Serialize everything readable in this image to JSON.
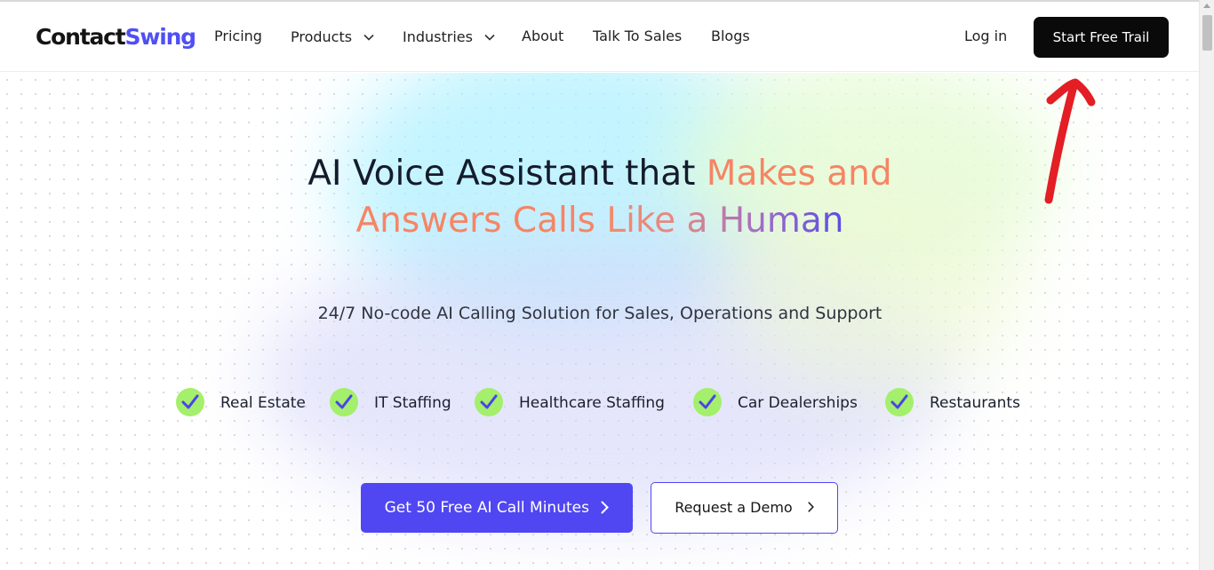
{
  "brand": {
    "logo_part1": "Contact",
    "logo_part2": "Swing",
    "accent_color": "#5046f2",
    "logo_swing_color": "#4f4ff5"
  },
  "nav": {
    "items": [
      {
        "label": "Pricing",
        "has_dropdown": false
      },
      {
        "label": "Products",
        "has_dropdown": true
      },
      {
        "label": "Industries",
        "has_dropdown": true
      },
      {
        "label": "About",
        "has_dropdown": false
      },
      {
        "label": "Talk To Sales",
        "has_dropdown": false
      },
      {
        "label": "Blogs",
        "has_dropdown": false
      }
    ],
    "login_label": "Log in",
    "cta_label": "Start Free Trail",
    "cta_color": "#0a0a0a"
  },
  "hero": {
    "headline_dark": "AI Voice Assistant that",
    "headline_orange_1": "Makes and",
    "headline_orange_2": "Answers Calls",
    "headline_gradient": "Like a Human",
    "subtitle": "24/7 No-code AI Calling Solution for Sales, Operations and Support",
    "industries": [
      {
        "label": "Real Estate",
        "icon": "check-circle-icon"
      },
      {
        "label": "IT Staffing",
        "icon": "check-circle-icon"
      },
      {
        "label": "Healthcare Staffing",
        "icon": "check-circle-icon"
      },
      {
        "label": "Car Dealerships",
        "icon": "check-circle-icon"
      },
      {
        "label": "Restaurants",
        "icon": "check-circle-icon"
      }
    ],
    "check_color": "#a4ef6b",
    "primary_cta": "Get 50 Free AI Call Minutes",
    "secondary_cta": "Request a Demo"
  },
  "annotation": {
    "icon": "red-arrow-annotation",
    "color": "#e31e24"
  }
}
